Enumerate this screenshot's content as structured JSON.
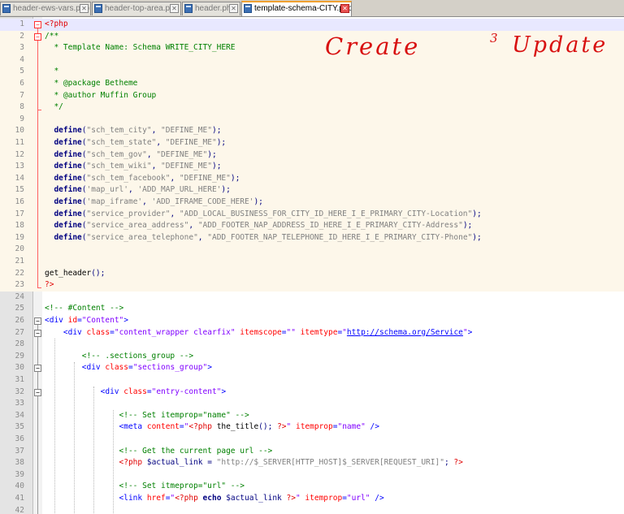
{
  "tabs": [
    {
      "label": "header-ews-vars.php",
      "active": false
    },
    {
      "label": "header-top-area.php",
      "active": false
    },
    {
      "label": "header.php",
      "active": false
    },
    {
      "label": "template-schema-CITY.php",
      "active": true
    }
  ],
  "close_glyph": "✕",
  "annotation": {
    "left": "Create",
    "mid": "3",
    "right": "Update",
    "color": "#d81010"
  },
  "lines": [
    {
      "n": "1",
      "t": [
        [
          "php",
          "<?php"
        ]
      ]
    },
    {
      "n": "2",
      "t": [
        [
          "c",
          "/**"
        ]
      ]
    },
    {
      "n": "3",
      "t": [
        [
          "c",
          "  * Template Name: Schema WRITE_CITY_HERE"
        ]
      ]
    },
    {
      "n": "4",
      "t": []
    },
    {
      "n": "5",
      "t": [
        [
          "c",
          "  *"
        ]
      ]
    },
    {
      "n": "6",
      "t": [
        [
          "c",
          "  * @package Betheme"
        ]
      ]
    },
    {
      "n": "7",
      "t": [
        [
          "c",
          "  * @author Muffin Group"
        ]
      ]
    },
    {
      "n": "8",
      "t": [
        [
          "c",
          "  */"
        ]
      ]
    },
    {
      "n": "9",
      "t": []
    },
    {
      "n": "10",
      "t": [
        [
          "n",
          "  "
        ],
        [
          "kw",
          "define"
        ],
        [
          "p",
          "("
        ],
        [
          "s",
          "\"sch_tem_city\""
        ],
        [
          "p",
          ", "
        ],
        [
          "s",
          "\"DEFINE_ME\""
        ],
        [
          "p",
          ");"
        ]
      ]
    },
    {
      "n": "11",
      "t": [
        [
          "n",
          "  "
        ],
        [
          "kw",
          "define"
        ],
        [
          "p",
          "("
        ],
        [
          "s",
          "\"sch_tem_state\""
        ],
        [
          "p",
          ", "
        ],
        [
          "s",
          "\"DEFINE_ME\""
        ],
        [
          "p",
          ");"
        ]
      ]
    },
    {
      "n": "12",
      "t": [
        [
          "n",
          "  "
        ],
        [
          "kw",
          "define"
        ],
        [
          "p",
          "("
        ],
        [
          "s",
          "\"sch_tem_gov\""
        ],
        [
          "p",
          ", "
        ],
        [
          "s",
          "\"DEFINE_ME\""
        ],
        [
          "p",
          ");"
        ]
      ]
    },
    {
      "n": "13",
      "t": [
        [
          "n",
          "  "
        ],
        [
          "kw",
          "define"
        ],
        [
          "p",
          "("
        ],
        [
          "s",
          "\"sch_tem_wiki\""
        ],
        [
          "p",
          ", "
        ],
        [
          "s",
          "\"DEFINE_ME\""
        ],
        [
          "p",
          ");"
        ]
      ]
    },
    {
      "n": "14",
      "t": [
        [
          "n",
          "  "
        ],
        [
          "kw",
          "define"
        ],
        [
          "p",
          "("
        ],
        [
          "s",
          "\"sch_tem_facebook\""
        ],
        [
          "p",
          ", "
        ],
        [
          "s",
          "\"DEFINE_ME\""
        ],
        [
          "p",
          ");"
        ]
      ]
    },
    {
      "n": "15",
      "t": [
        [
          "n",
          "  "
        ],
        [
          "kw",
          "define"
        ],
        [
          "p",
          "("
        ],
        [
          "s",
          "'map_url'"
        ],
        [
          "p",
          ", "
        ],
        [
          "s",
          "'ADD_MAP_URL_HERE'"
        ],
        [
          "p",
          ");"
        ]
      ]
    },
    {
      "n": "16",
      "t": [
        [
          "n",
          "  "
        ],
        [
          "kw",
          "define"
        ],
        [
          "p",
          "("
        ],
        [
          "s",
          "'map_iframe'"
        ],
        [
          "p",
          ", "
        ],
        [
          "s",
          "'ADD_IFRAME_CODE_HERE'"
        ],
        [
          "p",
          ");"
        ]
      ]
    },
    {
      "n": "17",
      "t": [
        [
          "n",
          "  "
        ],
        [
          "kw",
          "define"
        ],
        [
          "p",
          "("
        ],
        [
          "s",
          "\"service_provider\""
        ],
        [
          "p",
          ", "
        ],
        [
          "s",
          "\"ADD_LOCAL_BUSINESS_FOR_CITY_ID_HERE_I_E_PRIMARY_CITY-Location\""
        ],
        [
          "p",
          ");"
        ]
      ]
    },
    {
      "n": "18",
      "t": [
        [
          "n",
          "  "
        ],
        [
          "kw",
          "define"
        ],
        [
          "p",
          "("
        ],
        [
          "s",
          "\"service_area_address\""
        ],
        [
          "p",
          ", "
        ],
        [
          "s",
          "\"ADD_FOOTER_NAP_ADDRESS_ID_HERE_I_E_PRIMARY_CITY-Address\""
        ],
        [
          "p",
          ");"
        ]
      ]
    },
    {
      "n": "19",
      "t": [
        [
          "n",
          "  "
        ],
        [
          "kw",
          "define"
        ],
        [
          "p",
          "("
        ],
        [
          "s",
          "\"service_area_telephone\""
        ],
        [
          "p",
          ", "
        ],
        [
          "s",
          "\"ADD_FOOTER_NAP_TELEPHONE_ID_HERE_I_E_PRIMARY_CITY-Phone\""
        ],
        [
          "p",
          ");"
        ]
      ]
    },
    {
      "n": "20",
      "t": []
    },
    {
      "n": "21",
      "t": []
    },
    {
      "n": "22",
      "t": [
        [
          "n",
          "get_header"
        ],
        [
          "p",
          "();"
        ]
      ]
    },
    {
      "n": "23",
      "t": [
        [
          "php",
          "?>"
        ]
      ]
    },
    {
      "n": "24",
      "t": []
    },
    {
      "n": "25",
      "t": [
        [
          "c",
          "<!-- #Content -->"
        ]
      ]
    },
    {
      "n": "26",
      "t": [
        [
          "tag",
          "<div "
        ],
        [
          "attr",
          "id"
        ],
        [
          "tag",
          "="
        ],
        [
          "str",
          "\"Content\""
        ],
        [
          "tag",
          ">"
        ]
      ]
    },
    {
      "n": "27",
      "t": [
        [
          "n",
          "    "
        ],
        [
          "tag",
          "<div "
        ],
        [
          "attr",
          "class"
        ],
        [
          "tag",
          "="
        ],
        [
          "str",
          "\"content_wrapper clearfix\""
        ],
        [
          "attr",
          " itemscope"
        ],
        [
          "tag",
          "="
        ],
        [
          "str",
          "\"\""
        ],
        [
          "attr",
          " itemtype"
        ],
        [
          "tag",
          "="
        ],
        [
          "str",
          "\""
        ],
        [
          "url",
          "http://schema.org/Service"
        ],
        [
          "str",
          "\""
        ],
        [
          "tag",
          ">"
        ]
      ]
    },
    {
      "n": "28",
      "t": []
    },
    {
      "n": "29",
      "t": [
        [
          "n",
          "        "
        ],
        [
          "c",
          "<!-- .sections_group -->"
        ]
      ]
    },
    {
      "n": "30",
      "t": [
        [
          "n",
          "        "
        ],
        [
          "tag",
          "<div "
        ],
        [
          "attr",
          "class"
        ],
        [
          "tag",
          "="
        ],
        [
          "str",
          "\"sections_group\""
        ],
        [
          "tag",
          ">"
        ]
      ]
    },
    {
      "n": "31",
      "t": []
    },
    {
      "n": "32",
      "t": [
        [
          "n",
          "            "
        ],
        [
          "tag",
          "<div "
        ],
        [
          "attr",
          "class"
        ],
        [
          "tag",
          "="
        ],
        [
          "str",
          "\"entry-content\""
        ],
        [
          "tag",
          ">"
        ]
      ]
    },
    {
      "n": "33",
      "t": []
    },
    {
      "n": "34",
      "t": [
        [
          "n",
          "                "
        ],
        [
          "c",
          "<!-- Set itemprop=\"name\" -->"
        ]
      ]
    },
    {
      "n": "35",
      "t": [
        [
          "n",
          "                "
        ],
        [
          "tag",
          "<meta "
        ],
        [
          "attr",
          "content"
        ],
        [
          "tag",
          "="
        ],
        [
          "str",
          "\""
        ],
        [
          "php",
          "<?php"
        ],
        [
          "n",
          " the_title"
        ],
        [
          "p",
          "();"
        ],
        [
          "n",
          " "
        ],
        [
          "php",
          "?>"
        ],
        [
          "str",
          "\""
        ],
        [
          "attr",
          " itemprop"
        ],
        [
          "tag",
          "="
        ],
        [
          "str",
          "\"name\""
        ],
        [
          "tag",
          " />"
        ]
      ]
    },
    {
      "n": "36",
      "t": []
    },
    {
      "n": "37",
      "t": [
        [
          "n",
          "                "
        ],
        [
          "c",
          "<!-- Get the current page url -->"
        ]
      ]
    },
    {
      "n": "38",
      "t": [
        [
          "n",
          "                "
        ],
        [
          "php",
          "<?php"
        ],
        [
          "n",
          " "
        ],
        [
          "var",
          "$actual_link"
        ],
        [
          "p",
          " = "
        ],
        [
          "s",
          "\"http://$_SERVER[HTTP_HOST]$_SERVER[REQUEST_URI]\""
        ],
        [
          "p",
          ";"
        ],
        [
          "n",
          " "
        ],
        [
          "php",
          "?>"
        ]
      ]
    },
    {
      "n": "39",
      "t": []
    },
    {
      "n": "40",
      "t": [
        [
          "n",
          "                "
        ],
        [
          "c",
          "<!-- Set itmeprop=\"url\" -->"
        ]
      ]
    },
    {
      "n": "41",
      "t": [
        [
          "n",
          "                "
        ],
        [
          "tag",
          "<link "
        ],
        [
          "attr",
          "href"
        ],
        [
          "tag",
          "="
        ],
        [
          "str",
          "\""
        ],
        [
          "php",
          "<?php"
        ],
        [
          "kw",
          " echo"
        ],
        [
          "var",
          " $actual_link"
        ],
        [
          "n",
          " "
        ],
        [
          "php",
          "?>"
        ],
        [
          "str",
          "\""
        ],
        [
          "attr",
          " itemprop"
        ],
        [
          "tag",
          "="
        ],
        [
          "str",
          "\"url\""
        ],
        [
          "tag",
          " />"
        ]
      ]
    },
    {
      "n": "42",
      "t": []
    }
  ]
}
